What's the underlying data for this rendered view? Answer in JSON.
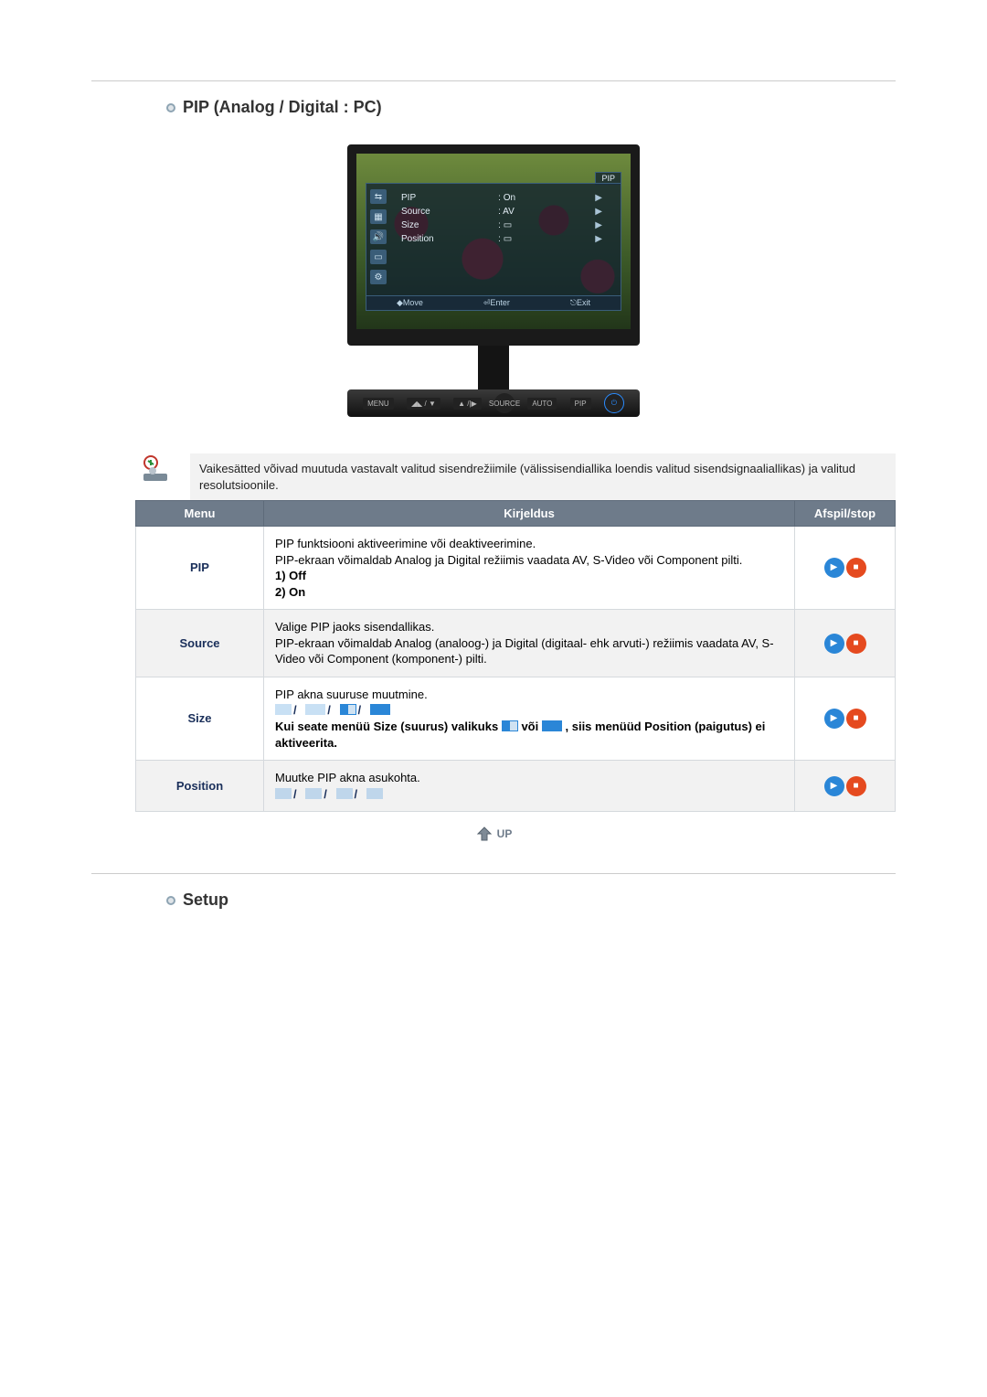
{
  "section1": {
    "title": "PIP (Analog / Digital : PC)"
  },
  "osd": {
    "tag": "PIP",
    "rows": [
      {
        "label": "PIP",
        "value": ": On"
      },
      {
        "label": "Source",
        "value": ": AV"
      },
      {
        "label": "Size",
        "value": ": ▭"
      },
      {
        "label": "Position",
        "value": ": ▭"
      }
    ],
    "footer": {
      "move": "◆Move",
      "enter": "⏎Enter",
      "exit": "⎋Exit"
    }
  },
  "monitor_buttons": {
    "menu": "MENU",
    "b2": "◢◣ / ▼",
    "b3": "▲ /|▶",
    "source": "SOURCE",
    "auto": "AUTO",
    "pip": "PIP",
    "power": "⏻"
  },
  "note": {
    "text": "Vaikesätted võivad muutuda vastavalt valitud sisendrežiimile (välissisendiallika loendis valitud sisendsignaaliallikas) ja valitud resolutsioonile."
  },
  "table": {
    "headers": {
      "menu": "Menu",
      "desc": "Kirjeldus",
      "play": "Afspil/stop"
    },
    "rows": [
      {
        "menu": "PIP",
        "desc": {
          "l1": "PIP funktsiooni aktiveerimine või deaktiveerimine.",
          "l2": "PIP-ekraan võimaldab Analog ja Digital režiimis vaadata AV, S-Video või Component pilti.",
          "opt1": "1) Off",
          "opt2": "2) On"
        }
      },
      {
        "menu": "Source",
        "desc_text": "Valige PIP jaoks sisendallikas.\nPIP-ekraan võimaldab Analog (analoog-) ja Digital (digitaal- ehk arvuti-) režiimis vaadata AV, S-Video või Component (komponent-) pilti."
      },
      {
        "menu": "Size",
        "desc": {
          "l1": "PIP akna suuruse muutmine.",
          "note1_a": "Kui seate menüü Size (suurus) valikuks",
          "note1_b": "või",
          "note1_c": ", siis menüüd Position (paigutus) ei aktiveerita."
        }
      },
      {
        "menu": "Position",
        "desc": {
          "l1": "Muutke PIP akna asukohta."
        }
      }
    ]
  },
  "up_label": "UP",
  "section2": {
    "title": "Setup"
  }
}
